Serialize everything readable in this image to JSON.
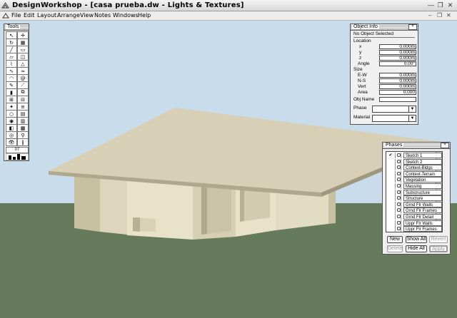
{
  "window": {
    "title": "DesignWorkshop - [casa prueba.dw - Lights & Textures]"
  },
  "menu": [
    "File",
    "Edit",
    "Layout",
    "Arrange",
    "View",
    "Notes",
    "Windows",
    "Help"
  ],
  "colors": {
    "sky": "#c8dcec",
    "ground": "#657b5c",
    "wall_light": "#e8e2c9",
    "wall_shade": "#c7c0a1",
    "roof_top": "#d7d0b7",
    "roof_edge": "#b0a88c"
  },
  "tools": {
    "title": "Tools",
    "icons": [
      "arrow-icon",
      "crosshair-icon",
      "rotate-icon",
      "grid-icon",
      "line-icon",
      "rectangle-icon",
      "rect-tool-icon",
      "box-icon",
      "polyline-icon",
      "triangle-icon",
      "path-icon",
      "wave-icon",
      "arc-icon",
      "spiral-icon",
      "eyedropper-icon",
      "slope-icon",
      "wall-icon",
      "copy-icon",
      "window-icon",
      "door-icon",
      "light-icon",
      "stairs-icon",
      "circle-icon",
      "mesh-icon",
      "sphere-icon",
      "table-icon",
      "cube-icon",
      "grid2-icon",
      "view-icon",
      "walk-icon",
      "eye-icon",
      "footprints-icon"
    ],
    "counter": "07"
  },
  "object_info": {
    "title": "Object Info",
    "status": "No Object Selected",
    "location_label": "Location",
    "x_label": "x",
    "x": "0.000m",
    "y_label": "y",
    "y": "0.000m",
    "z_label": "z",
    "z": "0.000m",
    "angle_label": "Angle",
    "angle": "0.00°",
    "size_label": "Size",
    "ew_label": "E-W",
    "ew": "0.000m",
    "ns_label": "N-S",
    "ns": "0.000m",
    "vert_label": "Vert",
    "vert": "0.000m",
    "area_label": "Area",
    "area": "0.000",
    "objname_label": "Obj Name",
    "phase_label": "Phase",
    "material_label": "Material"
  },
  "phases": {
    "title": "Phases",
    "items": [
      {
        "name": "Sketch 1",
        "checked": true
      },
      {
        "name": "Sketch 2",
        "checked": false
      },
      {
        "name": "Context-Bldgs",
        "checked": false
      },
      {
        "name": "Context-Terrain",
        "checked": false
      },
      {
        "name": "Vegetation",
        "checked": false
      },
      {
        "name": "Massing",
        "checked": false
      },
      {
        "name": "Substructure",
        "checked": false
      },
      {
        "name": "Structure",
        "checked": false
      },
      {
        "name": "Grnd Flr Walls",
        "checked": false
      },
      {
        "name": "Grnd Flr Frames",
        "checked": false
      },
      {
        "name": "Grnd Flr Detail",
        "checked": false
      },
      {
        "name": "Uppr Flr Walls",
        "checked": false
      },
      {
        "name": "Uppr Flr Frames",
        "checked": false
      }
    ],
    "new_label": "New",
    "show_all_label": "Show All",
    "revert_label": "Revert",
    "delete_label": "Delete",
    "hide_all_label": "Hide All",
    "apply_label": "Apply"
  }
}
